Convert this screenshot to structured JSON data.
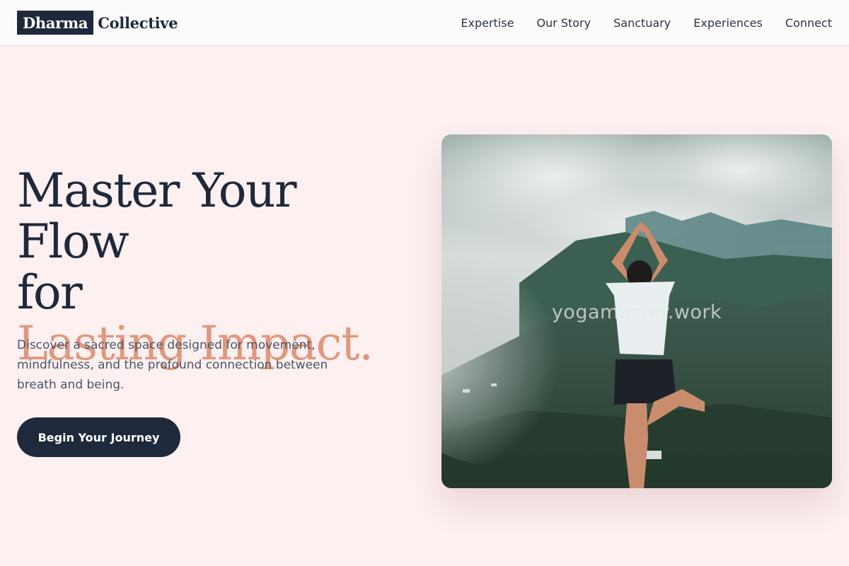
{
  "brand": {
    "logo_part1": "Dharma",
    "logo_part2": "Collective"
  },
  "nav": {
    "items": [
      {
        "label": "Expertise"
      },
      {
        "label": "Our Story"
      },
      {
        "label": "Sanctuary"
      },
      {
        "label": "Experiences"
      },
      {
        "label": "Connect"
      }
    ]
  },
  "hero": {
    "title_line1": "Master Your Flow",
    "title_line2": "for",
    "title_accent": "Lasting Impact.",
    "description": "Discover a sacred space designed for movement, mindfulness, and the profound connection between breath and being.",
    "cta_label": "Begin Your Journey",
    "image_watermark": "yogamaster.work"
  },
  "colors": {
    "background": "#fdf0f0",
    "primary": "#1e293b",
    "accent": "#e0997e",
    "body_text": "#4b5567"
  }
}
